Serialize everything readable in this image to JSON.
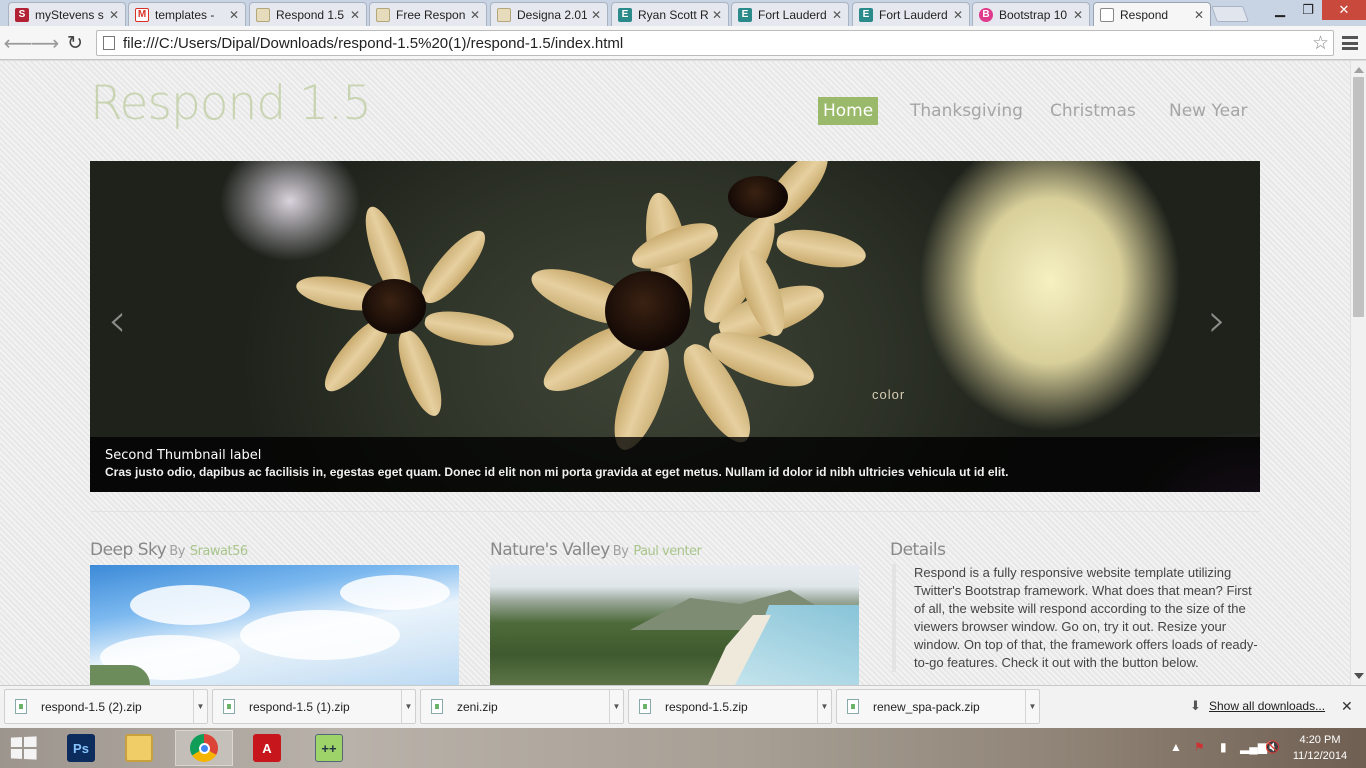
{
  "browser": {
    "tabs": [
      {
        "label": "myStevens s",
        "icon": "stevens-icon"
      },
      {
        "label": "templates - ",
        "icon": "gmail-icon"
      },
      {
        "label": "Respond 1.5",
        "icon": "page-icon"
      },
      {
        "label": "Free Respon",
        "icon": "page-icon"
      },
      {
        "label": "Designa 2.01",
        "icon": "page-icon"
      },
      {
        "label": "Ryan Scott R",
        "icon": "e-icon"
      },
      {
        "label": "Fort Lauderd",
        "icon": "e-icon"
      },
      {
        "label": "Fort Lauderd",
        "icon": "e-icon"
      },
      {
        "label": "Bootstrap 10",
        "icon": "bootstrap-icon"
      },
      {
        "label": "Respond",
        "icon": "page-icon",
        "active": true
      }
    ],
    "url": "file:///C:/Users/Dipal/Downloads/respond-1.5%20(1)/respond-1.5/index.html"
  },
  "site": {
    "title": "Respond 1.5",
    "nav": [
      {
        "label": "Home",
        "active": true
      },
      {
        "label": "Thanksgiving"
      },
      {
        "label": "Christmas"
      },
      {
        "label": "New Year"
      }
    ],
    "carousel": {
      "prev": "‹",
      "next": "›",
      "watermark": "color",
      "caption_title": "Second Thumbnail label",
      "caption_text": "Cras justo odio, dapibus ac facilisis in, egestas eget quam. Donec id elit non mi porta gravida at eget metus. Nullam id dolor id nibh ultricies vehicula ut id elit."
    },
    "posts": [
      {
        "title": "Deep Sky",
        "by": "By",
        "author": "Srawat56"
      },
      {
        "title": "Nature's Valley",
        "by": "By",
        "author": "Paul venter"
      }
    ],
    "details": {
      "title": "Details",
      "text": "Respond is a fully responsive website template utilizing Twitter's Bootstrap framework. What does that mean? First of all, the website will respond according to the size of the viewers browser window. Go on, try it out. Resize your window. On top of that, the framework offers loads of ready-to-go features. Check it out with the button below."
    }
  },
  "downloads": {
    "items": [
      "respond-1.5 (2).zip",
      "respond-1.5 (1).zip",
      "zeni.zip",
      "respond-1.5.zip",
      "renew_spa-pack.zip"
    ],
    "show_all": "Show all downloads..."
  },
  "taskbar": {
    "apps": [
      "photoshop",
      "file-explorer",
      "chrome",
      "acrobat",
      "notepad-plus"
    ],
    "time": "4:20 PM",
    "date": "11/12/2014"
  },
  "colors": {
    "accent_green": "#9ab96a",
    "title_green": "#c8d4b1",
    "author_green": "#a9c58c"
  }
}
